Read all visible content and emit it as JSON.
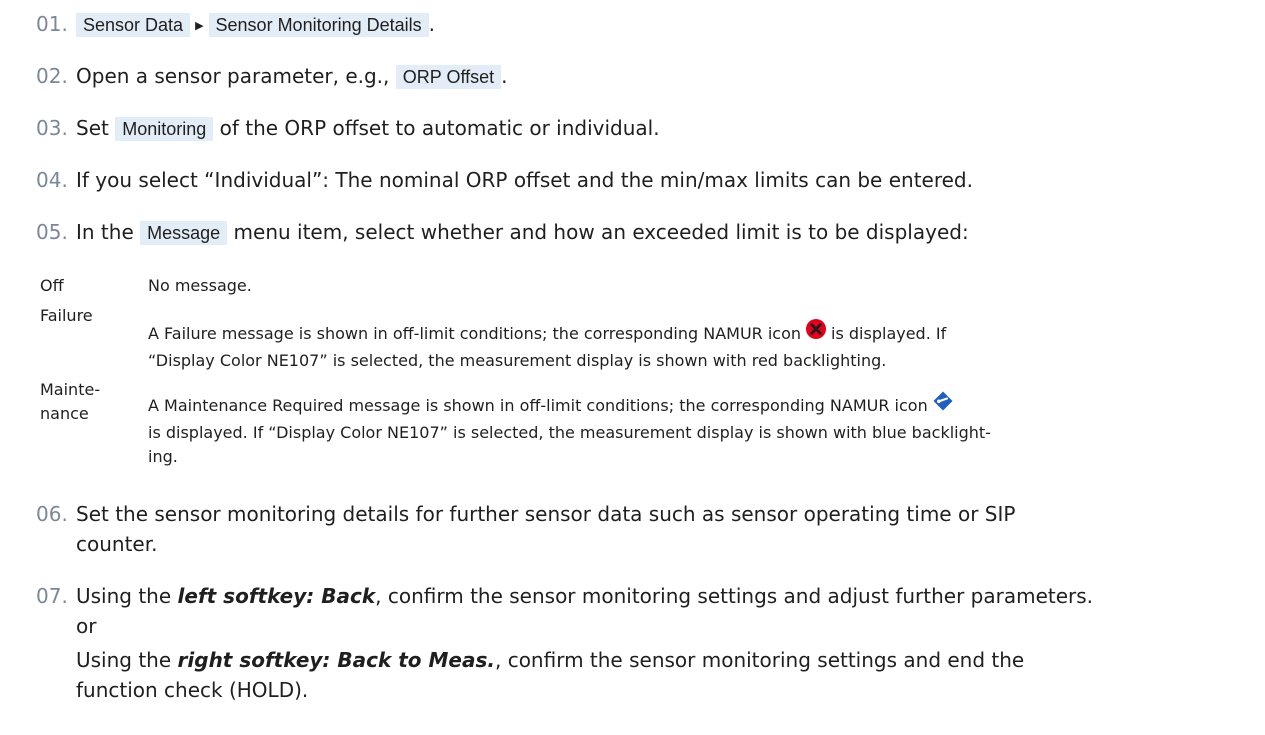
{
  "steps": {
    "s01": {
      "num": "01.",
      "path1": "Sensor Data",
      "path2": "Sensor Monitoring Details",
      "end": "."
    },
    "s02": {
      "num": "02.",
      "before": "Open a sensor parameter, e.g.,",
      "ui": "ORP Offset",
      "end": "."
    },
    "s03": {
      "num": "03.",
      "before": "Set",
      "ui": "Monitoring",
      "after": "of the ORP offset to automatic or individual."
    },
    "s04": {
      "num": "04.",
      "text": "If you select “Individual”: The nominal ORP offset and the min/max limits can be entered."
    },
    "s05": {
      "num": "05.",
      "before": "In the",
      "ui": "Message",
      "after": "menu item, select whether and how an exceeded limit is to be displayed:"
    },
    "s06": {
      "num": "06.",
      "line1": "Set the sensor monitoring details for further sensor data such as sensor operating time or SIP",
      "line2": "counter."
    },
    "s07": {
      "num": "07.",
      "a_before": "Using the",
      "a_key": "left softkey: Back",
      "a_after": ", confirm the sensor monitoring settings and adjust further parameters.",
      "or": "or",
      "b_before": "Using the",
      "b_key": "right softkey: Back to Meas.",
      "b_after": ", confirm the sensor monitoring settings and end the",
      "b_line2": "function check (HOLD)."
    }
  },
  "options": {
    "off": {
      "term": "Off",
      "desc": "No message."
    },
    "failure": {
      "term": "Failure",
      "desc1_before": "A Failure message is shown in off-limit conditions; the corresponding NAMUR icon",
      "desc1_after": "is displayed. If",
      "desc2": "“Display Color NE107” is selected, the measurement display is shown with red backlighting.",
      "icon": "namur-failure-icon",
      "icon_color": "#e3001b"
    },
    "maintenance": {
      "term1": "Mainte-",
      "term2": "nance",
      "desc1_before": "A Maintenance Required message is shown in off-limit conditions; the corresponding NAMUR icon",
      "desc2": "is displayed. If “Display Color NE107” is selected, the measurement display is shown with blue backlight-",
      "desc3": "ing.",
      "icon": "namur-maintenance-icon",
      "icon_color": "#1f5fbf"
    }
  }
}
